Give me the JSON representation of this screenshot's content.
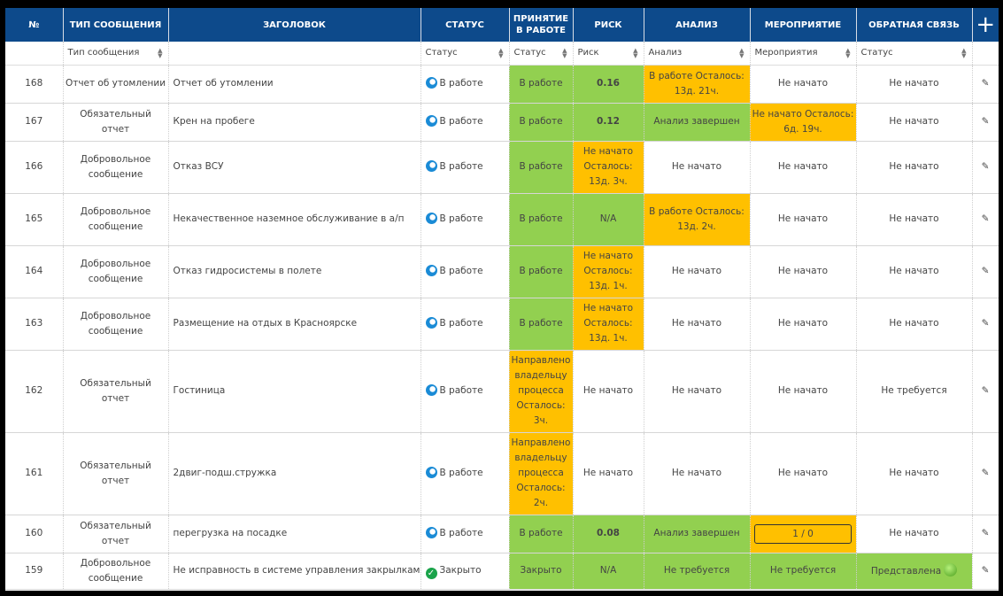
{
  "headers": {
    "num": "№",
    "type": "ТИП СООБЩЕНИЯ",
    "title": "ЗАГОЛОВОК",
    "status": "СТАТУС",
    "accept": "ПРИНЯТИЕ В РАБОТЕ",
    "risk": "РИСК",
    "analysis": "АНАЛИЗ",
    "measure": "МЕРОПРИЯТИЕ",
    "feedback": "ОБРАТНАЯ СВЯЗЬ",
    "add": "+"
  },
  "filters": {
    "type": "Тип сообщения",
    "status": "Статус",
    "accept": "Статус",
    "risk": "Риск",
    "analysis": "Анализ",
    "measure": "Мероприятия",
    "feedback": "Статус"
  },
  "colors": {
    "header": "#0d4a8b",
    "green": "#92d050",
    "orange": "#ffc000",
    "link": "#1e78c8"
  },
  "rows": [
    {
      "num": "168",
      "type": "Отчет об утомлении",
      "title": "Отчет об утомлении",
      "status": "В работе",
      "accept": "В работе",
      "risk": "0.16",
      "analysis": "В работе Осталось: 13д. 21ч.",
      "measure": "Не начато",
      "feedback": "Не начато"
    },
    {
      "num": "167",
      "type": "Обязательный отчет",
      "title": "Крен на пробеге",
      "status": "В работе",
      "accept": "В работе",
      "risk": "0.12",
      "analysis": "Анализ завершен",
      "measure": "Не начато Осталось: 6д. 19ч.",
      "feedback": "Не начато"
    },
    {
      "num": "166",
      "type": "Добровольное сообщение",
      "title": "Отказ ВСУ",
      "status": "В работе",
      "accept": "В работе",
      "risk": "Не начато Осталось: 13д. 3ч.",
      "analysis": "Не начато",
      "measure": "Не начато",
      "feedback": "Не начато"
    },
    {
      "num": "165",
      "type": "Добровольное сообщение",
      "title": "Некачественное наземное обслуживание в а/п",
      "status": "В работе",
      "accept": "В работе",
      "risk": "N/A",
      "analysis": "В работе Осталось: 13д. 2ч.",
      "measure": "Не начато",
      "feedback": "Не начато"
    },
    {
      "num": "164",
      "type": "Добровольное сообщение",
      "title": "Отказ гидросистемы в полете",
      "status": "В работе",
      "accept": "В работе",
      "risk": "Не начато Осталось: 13д. 1ч.",
      "analysis": "Не начато",
      "measure": "Не начато",
      "feedback": "Не начато"
    },
    {
      "num": "163",
      "type": "Добровольное сообщение",
      "title": "Размещение на отдых в Красноярске",
      "status": "В работе",
      "accept": "В работе",
      "risk": "Не начато Осталось: 13д. 1ч.",
      "analysis": "Не начато",
      "measure": "Не начато",
      "feedback": "Не начато"
    },
    {
      "num": "162",
      "type": "Обязательный отчет",
      "title": "Гостиница",
      "status": "В работе",
      "accept": "Направлено владельцу процесса Осталось: 3ч.",
      "risk": "Не начато",
      "analysis": "Не начато",
      "measure": "Не начато",
      "feedback": "Не требуется"
    },
    {
      "num": "161",
      "type": "Обязательный отчет",
      "title": "2двиг-подш.стружка",
      "status": "В работе",
      "accept": "Направлено владельцу процесса Осталось: 2ч.",
      "risk": "Не начато",
      "analysis": "Не начато",
      "measure": "Не начато",
      "feedback": "Не начато"
    },
    {
      "num": "160",
      "type": "Обязательный отчет",
      "title": "перегрузка на посадке",
      "status": "В работе",
      "accept": "В работе",
      "risk": "0.08",
      "analysis": "Анализ завершен",
      "measure": "1 / 0",
      "feedback": "Не начато"
    },
    {
      "num": "159",
      "type": "Добровольное сообщение",
      "title": "Не исправность в системе управления закрылками.",
      "status": "Закрыто",
      "accept": "Закрыто",
      "risk": "N/A",
      "analysis": "Не требуется",
      "measure": "Не требуется",
      "feedback": "Представлена"
    }
  ]
}
